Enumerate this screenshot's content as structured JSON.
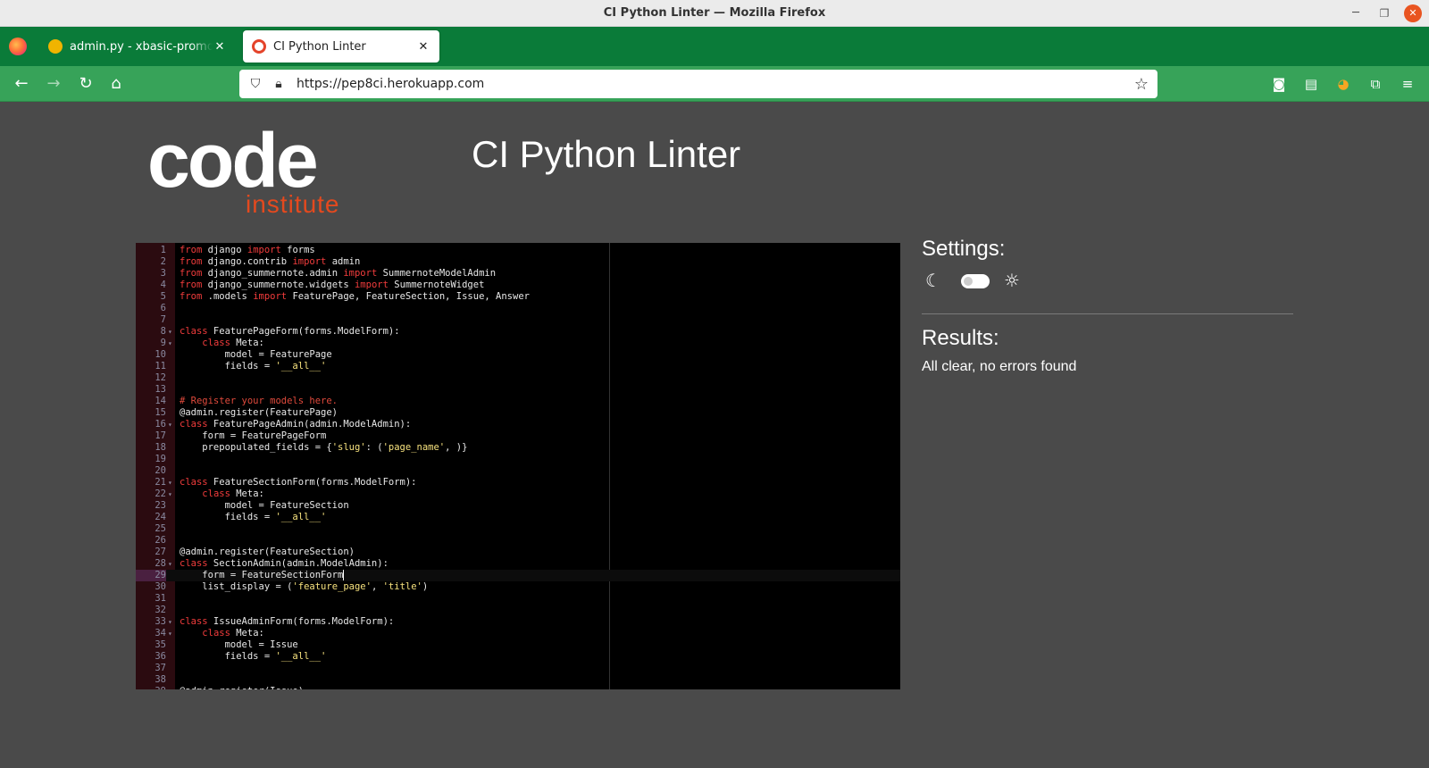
{
  "window": {
    "title": "CI Python Linter — Mozilla Firefox"
  },
  "tabs": [
    {
      "label": "admin.py - xbasic-promo - C",
      "active": false
    },
    {
      "label": "CI Python Linter",
      "active": true
    }
  ],
  "navbar": {
    "url": "https://pep8ci.herokuapp.com"
  },
  "logo": {
    "word": "code",
    "sub": "institute"
  },
  "app": {
    "title": "CI Python Linter"
  },
  "settings": {
    "title": "Settings:",
    "theme_toggle": "off"
  },
  "results": {
    "title": "Results:",
    "text": "All clear, no errors found"
  },
  "colors": {
    "accent": "#e4491e",
    "tabstrip": "#0a7b39",
    "navbar": "#37a359"
  },
  "editor": {
    "active_line": 29,
    "lines": [
      {
        "n": "1",
        "fold": "",
        "html": "<span class=\"kw\">from</span> django <span class=\"kw\">import</span> forms"
      },
      {
        "n": "2",
        "fold": "",
        "html": "<span class=\"kw\">from</span> django.contrib <span class=\"kw\">import</span> admin"
      },
      {
        "n": "3",
        "fold": "",
        "html": "<span class=\"kw\">from</span> django_summernote.admin <span class=\"kw\">import</span> SummernoteModelAdmin"
      },
      {
        "n": "4",
        "fold": "",
        "html": "<span class=\"kw\">from</span> django_summernote.widgets <span class=\"kw\">import</span> SummernoteWidget"
      },
      {
        "n": "5",
        "fold": "",
        "html": "<span class=\"kw\">from</span> .models <span class=\"kw\">import</span> FeaturePage, FeatureSection, Issue, Answer"
      },
      {
        "n": "6",
        "fold": "",
        "html": ""
      },
      {
        "n": "7",
        "fold": "",
        "html": ""
      },
      {
        "n": "8",
        "fold": "▾",
        "html": "<span class=\"kw\">class</span> FeaturePageForm(forms.ModelForm):"
      },
      {
        "n": "9",
        "fold": "▾",
        "html": "    <span class=\"kw\">class</span> Meta:"
      },
      {
        "n": "10",
        "fold": "",
        "html": "        model = FeaturePage"
      },
      {
        "n": "11",
        "fold": "",
        "html": "        fields = <span class=\"str\">'__all__'</span>"
      },
      {
        "n": "12",
        "fold": "",
        "html": ""
      },
      {
        "n": "13",
        "fold": "",
        "html": ""
      },
      {
        "n": "14",
        "fold": "",
        "html": "<span class=\"cm\"># Register your models here.</span>"
      },
      {
        "n": "15",
        "fold": "",
        "html": "@admin.register(FeaturePage)"
      },
      {
        "n": "16",
        "fold": "▾",
        "html": "<span class=\"kw\">class</span> FeaturePageAdmin(admin.ModelAdmin):"
      },
      {
        "n": "17",
        "fold": "",
        "html": "    form = FeaturePageForm"
      },
      {
        "n": "18",
        "fold": "",
        "html": "    prepopulated_fields = {<span class=\"str\">'slug'</span>: (<span class=\"str\">'page_name'</span>, )}"
      },
      {
        "n": "19",
        "fold": "",
        "html": ""
      },
      {
        "n": "20",
        "fold": "",
        "html": ""
      },
      {
        "n": "21",
        "fold": "▾",
        "html": "<span class=\"kw\">class</span> FeatureSectionForm(forms.ModelForm):"
      },
      {
        "n": "22",
        "fold": "▾",
        "html": "    <span class=\"kw\">class</span> Meta:"
      },
      {
        "n": "23",
        "fold": "",
        "html": "        model = FeatureSection"
      },
      {
        "n": "24",
        "fold": "",
        "html": "        fields = <span class=\"str\">'__all__'</span>"
      },
      {
        "n": "25",
        "fold": "",
        "html": ""
      },
      {
        "n": "26",
        "fold": "",
        "html": ""
      },
      {
        "n": "27",
        "fold": "",
        "html": "@admin.register(FeatureSection)"
      },
      {
        "n": "28",
        "fold": "▾",
        "html": "<span class=\"kw\">class</span> SectionAdmin(admin.ModelAdmin):"
      },
      {
        "n": "29",
        "fold": "",
        "html": "    form = FeatureSectionForm<span class=\"caret\"></span>"
      },
      {
        "n": "30",
        "fold": "",
        "html": "    list_display = (<span class=\"str\">'feature_page'</span>, <span class=\"str\">'title'</span>)"
      },
      {
        "n": "31",
        "fold": "",
        "html": ""
      },
      {
        "n": "32",
        "fold": "",
        "html": ""
      },
      {
        "n": "33",
        "fold": "▾",
        "html": "<span class=\"kw\">class</span> IssueAdminForm(forms.ModelForm):"
      },
      {
        "n": "34",
        "fold": "▾",
        "html": "    <span class=\"kw\">class</span> Meta:"
      },
      {
        "n": "35",
        "fold": "",
        "html": "        model = Issue"
      },
      {
        "n": "36",
        "fold": "",
        "html": "        fields = <span class=\"str\">'__all__'</span>"
      },
      {
        "n": "37",
        "fold": "",
        "html": ""
      },
      {
        "n": "38",
        "fold": "",
        "html": ""
      },
      {
        "n": "39",
        "fold": "",
        "html": "@admin.register(Issue)"
      }
    ]
  }
}
